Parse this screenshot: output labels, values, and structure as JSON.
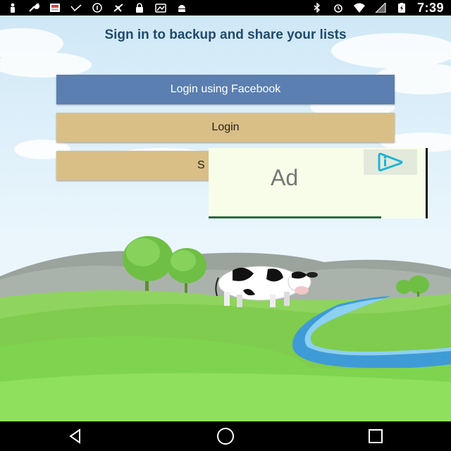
{
  "status_bar": {
    "time": "7:39",
    "left_icons": [
      "person-icon",
      "wrench-icon",
      "gallery-icon",
      "voicemail-icon",
      "info-icon",
      "satellite-icon",
      "lock-icon",
      "photo-icon",
      "android-icon"
    ],
    "right_icons": [
      "bluetooth-icon",
      "alarm-icon",
      "wifi-icon",
      "signal-icon",
      "battery-icon"
    ]
  },
  "main": {
    "heading": "Sign in to backup and share your lists",
    "buttons": {
      "facebook": "Login using Facebook",
      "login": "Login",
      "signup_partial": "S"
    }
  },
  "ad": {
    "label": "Ad",
    "badge_icon": "ad-info-icon"
  },
  "colors": {
    "facebook_button": "#5a7fb0",
    "login_button": "#d9bf86",
    "heading": "#204a6e",
    "grass": "#7ed957"
  },
  "nav_bar": {
    "buttons": [
      "back-icon",
      "home-icon",
      "recents-icon"
    ]
  }
}
